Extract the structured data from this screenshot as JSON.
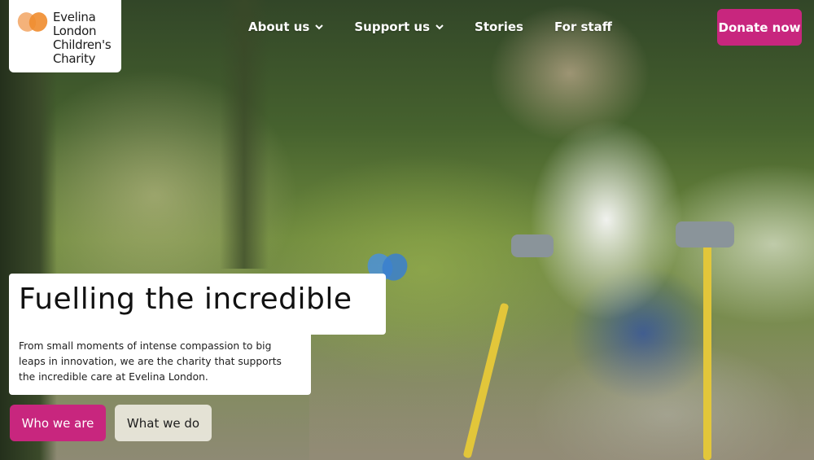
{
  "logo": {
    "line1": "Evelina",
    "line2": "London",
    "line3": "Children's",
    "line4": "Charity",
    "icon": "heart-logo-icon",
    "colors": [
      "#f08c2e",
      "#f4b27a"
    ]
  },
  "nav": {
    "items": [
      {
        "label": "About us",
        "has_dropdown": true
      },
      {
        "label": "Support us",
        "has_dropdown": true
      },
      {
        "label": "Stories",
        "has_dropdown": false
      },
      {
        "label": "For staff",
        "has_dropdown": false
      }
    ],
    "donate_label": "Donate now"
  },
  "hero": {
    "headline": "Fuelling the incredible",
    "description": "From small moments of intense compassion to big leaps in innovation, we are the charity that supports the incredible care at Evelina London.",
    "primary_button": "Who we are",
    "secondary_button": "What we do",
    "decorative_icon": "blue-heart-icon"
  },
  "colors": {
    "brand_pink": "#c8267e",
    "heart_blue": "#4a90d9"
  }
}
